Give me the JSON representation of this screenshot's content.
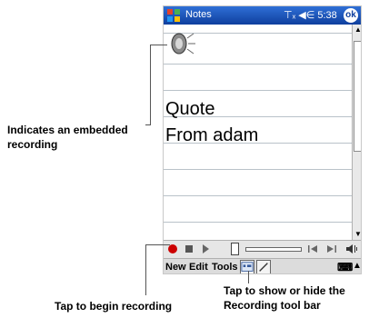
{
  "window": {
    "app_name": "Notes",
    "status_icons": "⊤ₓ ◀∈ 5:38",
    "ok_label": "ok"
  },
  "note": {
    "lines": [
      "Quote",
      "From adam"
    ]
  },
  "menu": {
    "new": "New",
    "edit": "Edit",
    "tools": "Tools"
  },
  "annotations": {
    "embedded": "Indicates an embedded recording",
    "begin": "Tap to begin recording",
    "toggle": "Tap to show or hide the Recording tool bar"
  },
  "colors": {
    "titlebar": "#1b55c0",
    "record": "#cc0000"
  }
}
